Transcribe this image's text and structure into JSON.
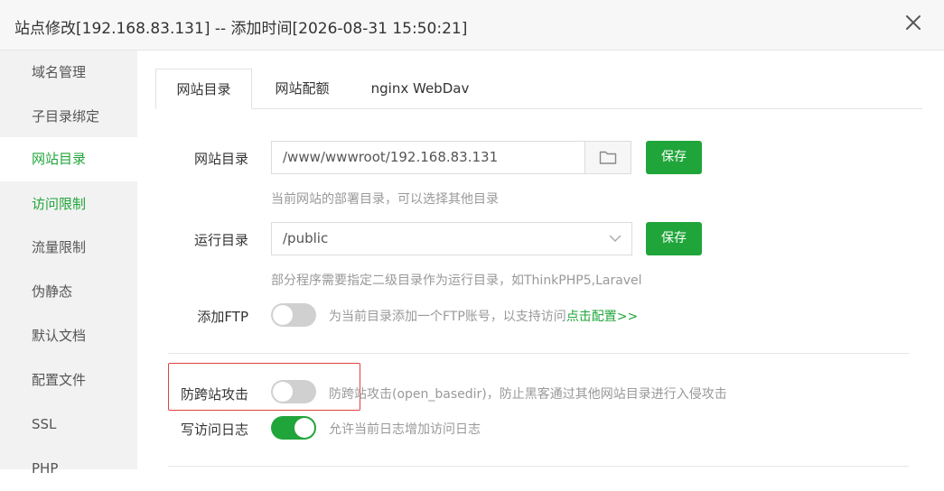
{
  "dialog": {
    "title": "站点修改[192.168.83.131] -- 添加时间[2026-08-31 15:50:21]",
    "close_icon": "close-icon"
  },
  "sidebar": {
    "items": [
      {
        "label": "域名管理"
      },
      {
        "label": "子目录绑定"
      },
      {
        "label": "网站目录",
        "active": true
      },
      {
        "label": "访问限制"
      },
      {
        "label": "流量限制"
      },
      {
        "label": "伪静态"
      },
      {
        "label": "默认文档"
      },
      {
        "label": "配置文件"
      },
      {
        "label": "SSL"
      },
      {
        "label": "PHP"
      }
    ]
  },
  "tabs": [
    {
      "label": "网站目录",
      "active": true
    },
    {
      "label": "网站配额"
    },
    {
      "label": "nginx WebDav"
    }
  ],
  "form": {
    "site_dir": {
      "label": "网站目录",
      "value": "/www/wwwroot/192.168.83.131",
      "folder_icon": "folder-icon",
      "save_label": "保存",
      "hint": "当前网站的部署目录，可以选择其他目录"
    },
    "run_dir": {
      "label": "运行目录",
      "value": "/public",
      "save_label": "保存",
      "hint": "部分程序需要指定二级目录作为运行目录，如ThinkPHP5,Laravel"
    },
    "add_ftp": {
      "label": "添加FTP",
      "enabled": false,
      "hint": "为当前目录添加一个FTP账号，以支持访问",
      "link": "点击配置>>"
    },
    "anti_xss": {
      "label": "防跨站攻击",
      "enabled": false,
      "hint": "防跨站攻击(open_basedir)，防止黑客通过其他网站目录进行入侵攻击"
    },
    "access_log": {
      "label": "写访问日志",
      "enabled": true,
      "hint": "允许当前日志增加访问日志"
    }
  },
  "colors": {
    "accent": "#20a53a",
    "highlight": "#e34040"
  }
}
